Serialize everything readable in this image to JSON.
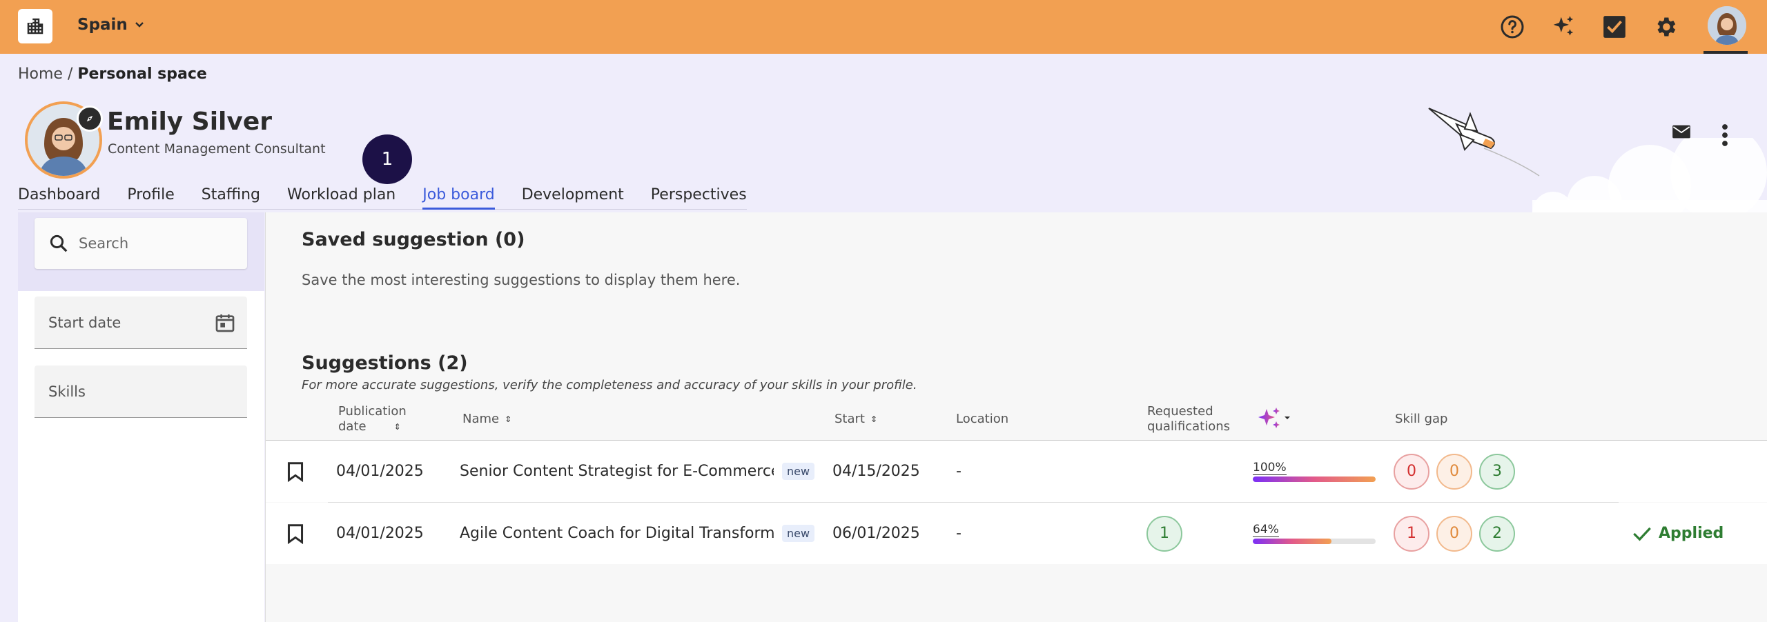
{
  "topbar": {
    "country": "Spain",
    "icons": [
      "help-icon",
      "sparkle-icon",
      "task-check-icon",
      "gear-icon"
    ],
    "color": "#f2a052"
  },
  "breadcrumb": {
    "home": "Home",
    "separator": " / ",
    "current": "Personal space"
  },
  "profile": {
    "name": "Emily Silver",
    "role": "Content Management Consultant",
    "notification_count": "1"
  },
  "tabs": [
    {
      "label": "Dashboard",
      "active": false
    },
    {
      "label": "Profile",
      "active": false
    },
    {
      "label": "Staffing",
      "active": false
    },
    {
      "label": "Workload plan",
      "active": false
    },
    {
      "label": "Job board",
      "active": true
    },
    {
      "label": "Development",
      "active": false
    },
    {
      "label": "Perspectives",
      "active": false
    }
  ],
  "filters": {
    "search_placeholder": "Search",
    "start_date_label": "Start date",
    "skills_label": "Skills"
  },
  "saved": {
    "title": "Saved suggestion (0)",
    "description": "Save the most interesting suggestions to display them here."
  },
  "suggestions": {
    "title": "Suggestions (2)",
    "note": "For more accurate suggestions, verify the completeness and accuracy of your skills in your profile.",
    "columns": {
      "publication_date_1": "Publication",
      "publication_date_2": "date",
      "name": "Name",
      "start": "Start",
      "location": "Location",
      "requested_1": "Requested",
      "requested_2": "qualifications",
      "skill_gap": "Skill gap"
    },
    "new_tag": "new",
    "rows": [
      {
        "publication_date": "04/01/2025",
        "name": "Senior Content Strategist for E-Commerce ...",
        "start": "04/15/2025",
        "location": "-",
        "requested": "",
        "match": "100%",
        "match_value": 100,
        "gap": [
          "0",
          "0",
          "3"
        ],
        "status": ""
      },
      {
        "publication_date": "04/01/2025",
        "name": "Agile Content Coach for Digital Transforma...",
        "start": "06/01/2025",
        "location": "-",
        "requested": "1",
        "match": "64%",
        "match_value": 64,
        "gap": [
          "1",
          "0",
          "2"
        ],
        "status": "Applied"
      }
    ]
  }
}
